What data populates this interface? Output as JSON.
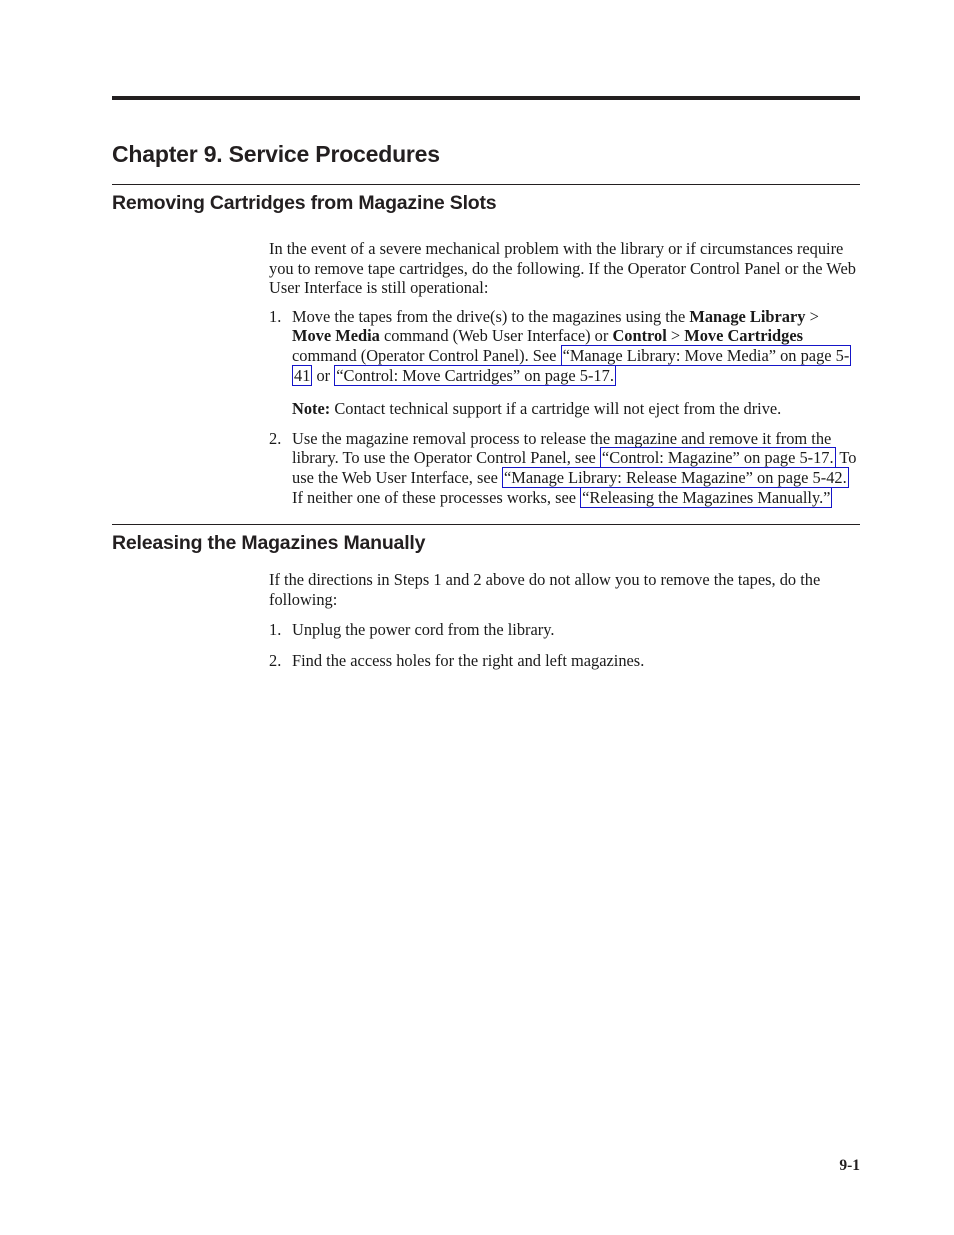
{
  "document": {
    "page_number": "9-1"
  },
  "chapter": {
    "title": "Chapter 9. Service Procedures"
  },
  "sections": [
    {
      "heading": "Removing Cartridges from Magazine Slots",
      "intro": "In the event of a severe mechanical problem with the library or if circumstances require you to remove tape cartridges, do the following. If the Operator Control Panel or the Web User Interface is still operational:",
      "steps": [
        {
          "marker": "1.",
          "segments": [
            {
              "type": "text",
              "value": "Move the tapes from the drive(s) to the magazines using the "
            },
            {
              "type": "bold",
              "value": "Manage Library"
            },
            {
              "type": "text",
              "value": " > "
            },
            {
              "type": "bold",
              "value": "Move Media"
            },
            {
              "type": "text",
              "value": " command (Web User Interface) or "
            },
            {
              "type": "bold",
              "value": "Control"
            },
            {
              "type": "text",
              "value": " > "
            },
            {
              "type": "bold",
              "value": "Move Cartridges"
            },
            {
              "type": "text",
              "value": " command (Operator Control Panel). See "
            },
            {
              "type": "link",
              "value": "“Manage Library: Move Media” on page 5-41"
            },
            {
              "type": "text",
              "value": " or "
            },
            {
              "type": "link",
              "value": "“Control: Move Cartridges” on page 5-17."
            }
          ]
        }
      ],
      "note": {
        "label": "Note:",
        "text": "Contact technical support if a cartridge will not eject from the drive."
      },
      "steps2": [
        {
          "marker": "2.",
          "segments": [
            {
              "type": "text",
              "value": "Use the magazine removal process to release the magazine and remove it from the library. To use the Operator Control Panel, see "
            },
            {
              "type": "link",
              "value": "“Control: Magazine” on page 5-17."
            },
            {
              "type": "text",
              "value": " To use the Web User Interface, see "
            },
            {
              "type": "link",
              "value": "“Manage Library: Release Magazine” on page 5-42."
            },
            {
              "type": "text",
              "value": " If neither one of these processes works, see "
            },
            {
              "type": "link",
              "value": "“Releasing the Magazines Manually.”"
            }
          ]
        }
      ]
    },
    {
      "heading": "Releasing the Magazines Manually",
      "intro": "If the directions in Steps 1 and 2 above do not allow you to remove the tapes, do the following:",
      "steps": [
        {
          "marker": "1.",
          "text": "Unplug the power cord from the library."
        },
        {
          "marker": "2.",
          "text": "Find the access holes for the right and left magazines."
        }
      ]
    }
  ],
  "colors": {
    "link_border": "#1515c8",
    "rule": "#231f20",
    "text": "#1a1a1a"
  }
}
